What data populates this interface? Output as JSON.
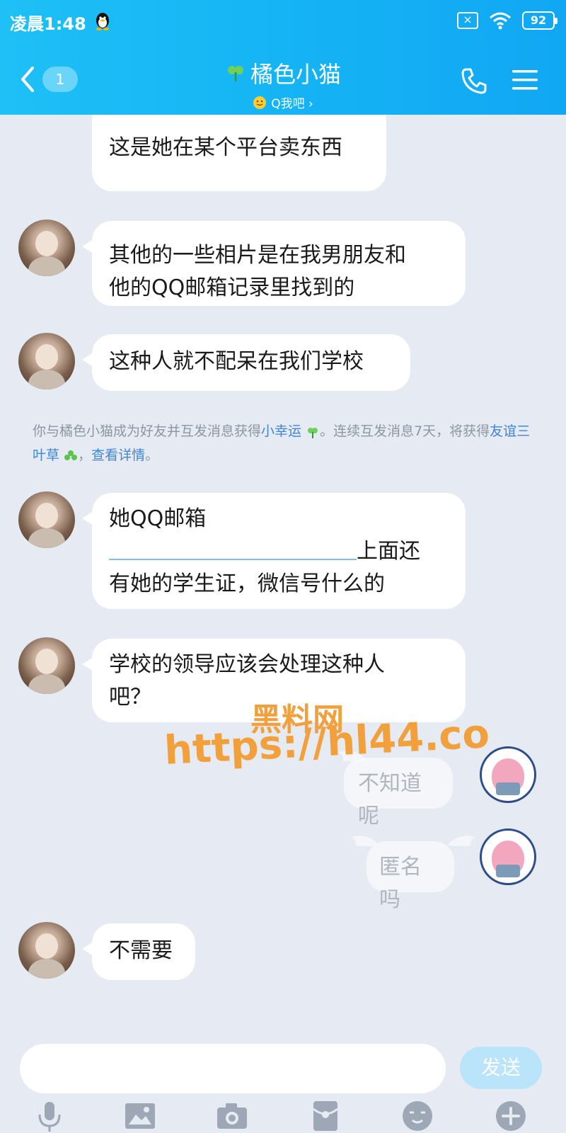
{
  "status_bar": {
    "time": "凌晨1:48",
    "battery": "92",
    "sim_label": "×"
  },
  "header": {
    "back_badge": "1",
    "title": "橘色小猫",
    "subtitle": "Q我吧 ›",
    "icons": [
      "back-chevron-icon",
      "clover-icon",
      "smiley-icon",
      "phone-icon",
      "menu-icon"
    ]
  },
  "messages": [
    {
      "side": "left",
      "text": "这是她在某个平台卖东西"
    },
    {
      "side": "left",
      "lines": [
        "其他的一些相片是在我男朋友和",
        "他的QQ邮箱记录里找到的"
      ]
    },
    {
      "side": "left",
      "text": "这种人就不配呆在我们学校"
    },
    {
      "side": "left",
      "lines": [
        "她QQ邮箱",
        "上面还",
        "有她的学生证，微信号什么的"
      ]
    },
    {
      "side": "left",
      "lines": [
        "学校的领导应该会处理这种人",
        "吧？"
      ]
    },
    {
      "side": "right",
      "text": "不知道呢"
    },
    {
      "side": "right",
      "text": "匿名吗"
    },
    {
      "side": "left",
      "text": "不需要"
    }
  ],
  "system_message": {
    "part1": "你与橘色小猫成为好友并互发消息获得",
    "link1": "小幸运",
    "part2": "。连续互发消息7天，将获得",
    "link2": "友谊三叶草",
    "part3": "，",
    "link3": "查看详情",
    "part4": "。"
  },
  "watermark": {
    "line1": "黑料网",
    "line2": "https://hl44.co"
  },
  "input": {
    "value": "",
    "send_label": "发送"
  },
  "toolbar_icons": [
    "microphone-icon",
    "image-icon",
    "camera-icon",
    "red-packet-icon",
    "emoji-icon",
    "plus-icon"
  ],
  "colors": {
    "header": "#15b4f5",
    "background": "#e6eaf2",
    "link": "#3f86d6",
    "watermark": "#f2a03b"
  }
}
